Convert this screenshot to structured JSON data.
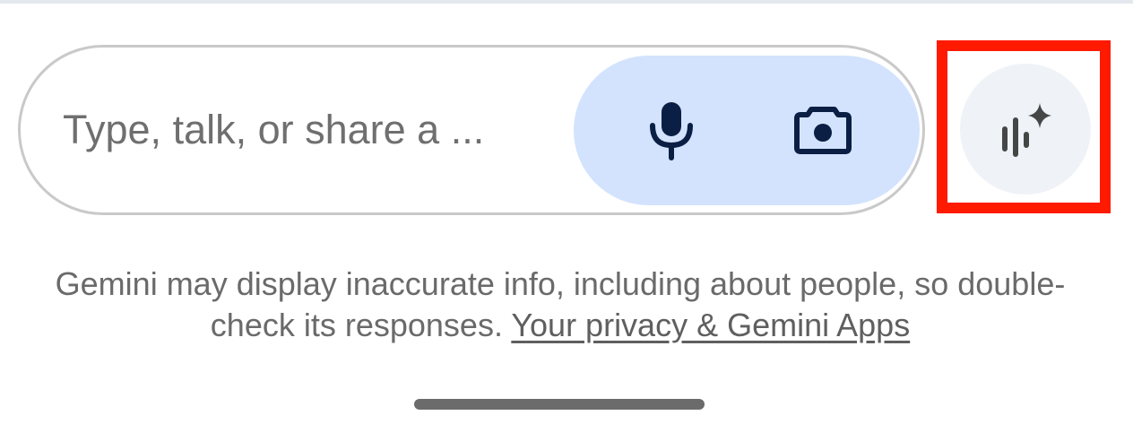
{
  "input": {
    "placeholder": "Type, talk, or share a ..."
  },
  "icons": {
    "mic": "microphone-icon",
    "camera": "camera-icon",
    "live": "gemini-live-sparkle-icon"
  },
  "disclaimer": {
    "text": "Gemini may display inaccurate info, including about people, so double-check its responses.",
    "link_label": "Your privacy & Gemini Apps"
  },
  "colors": {
    "action_group_bg": "#d3e3fd",
    "icon_dark": "#0b1f44",
    "highlight": "#ff1a00",
    "live_button_bg": "#eff2f7"
  }
}
